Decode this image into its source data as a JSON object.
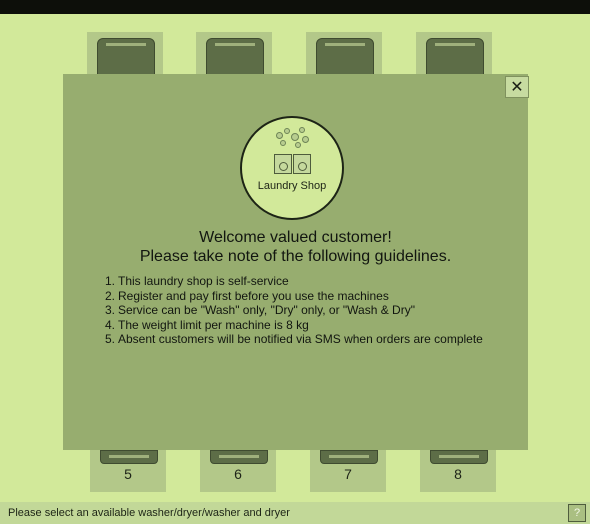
{
  "machines": {
    "bottom_numbers": [
      "5",
      "6",
      "7",
      "8"
    ]
  },
  "modal": {
    "close_label": "✕",
    "logo_text": "Laundry Shop",
    "heading_line1": "Welcome valued customer!",
    "heading_line2": "Please take note of the following guidelines.",
    "rules": [
      {
        "num": "1.",
        "text": "This laundry shop is self-service"
      },
      {
        "num": "2.",
        "text": "Register and pay first before  you use the machines"
      },
      {
        "num": "3.",
        "text": "Service can be \"Wash\" only, \"Dry\" only, or \"Wash & Dry\""
      },
      {
        "num": "4.",
        "text": "The weight limit per machine is 8 kg"
      },
      {
        "num": "5.",
        "text": "Absent customers will be notified via SMS when orders are complete"
      }
    ]
  },
  "status": {
    "message": "Please select an available washer/dryer/washer and dryer",
    "help_label": "?"
  },
  "colors": {
    "background": "#d2e99a",
    "modal": "#97ad6f"
  }
}
